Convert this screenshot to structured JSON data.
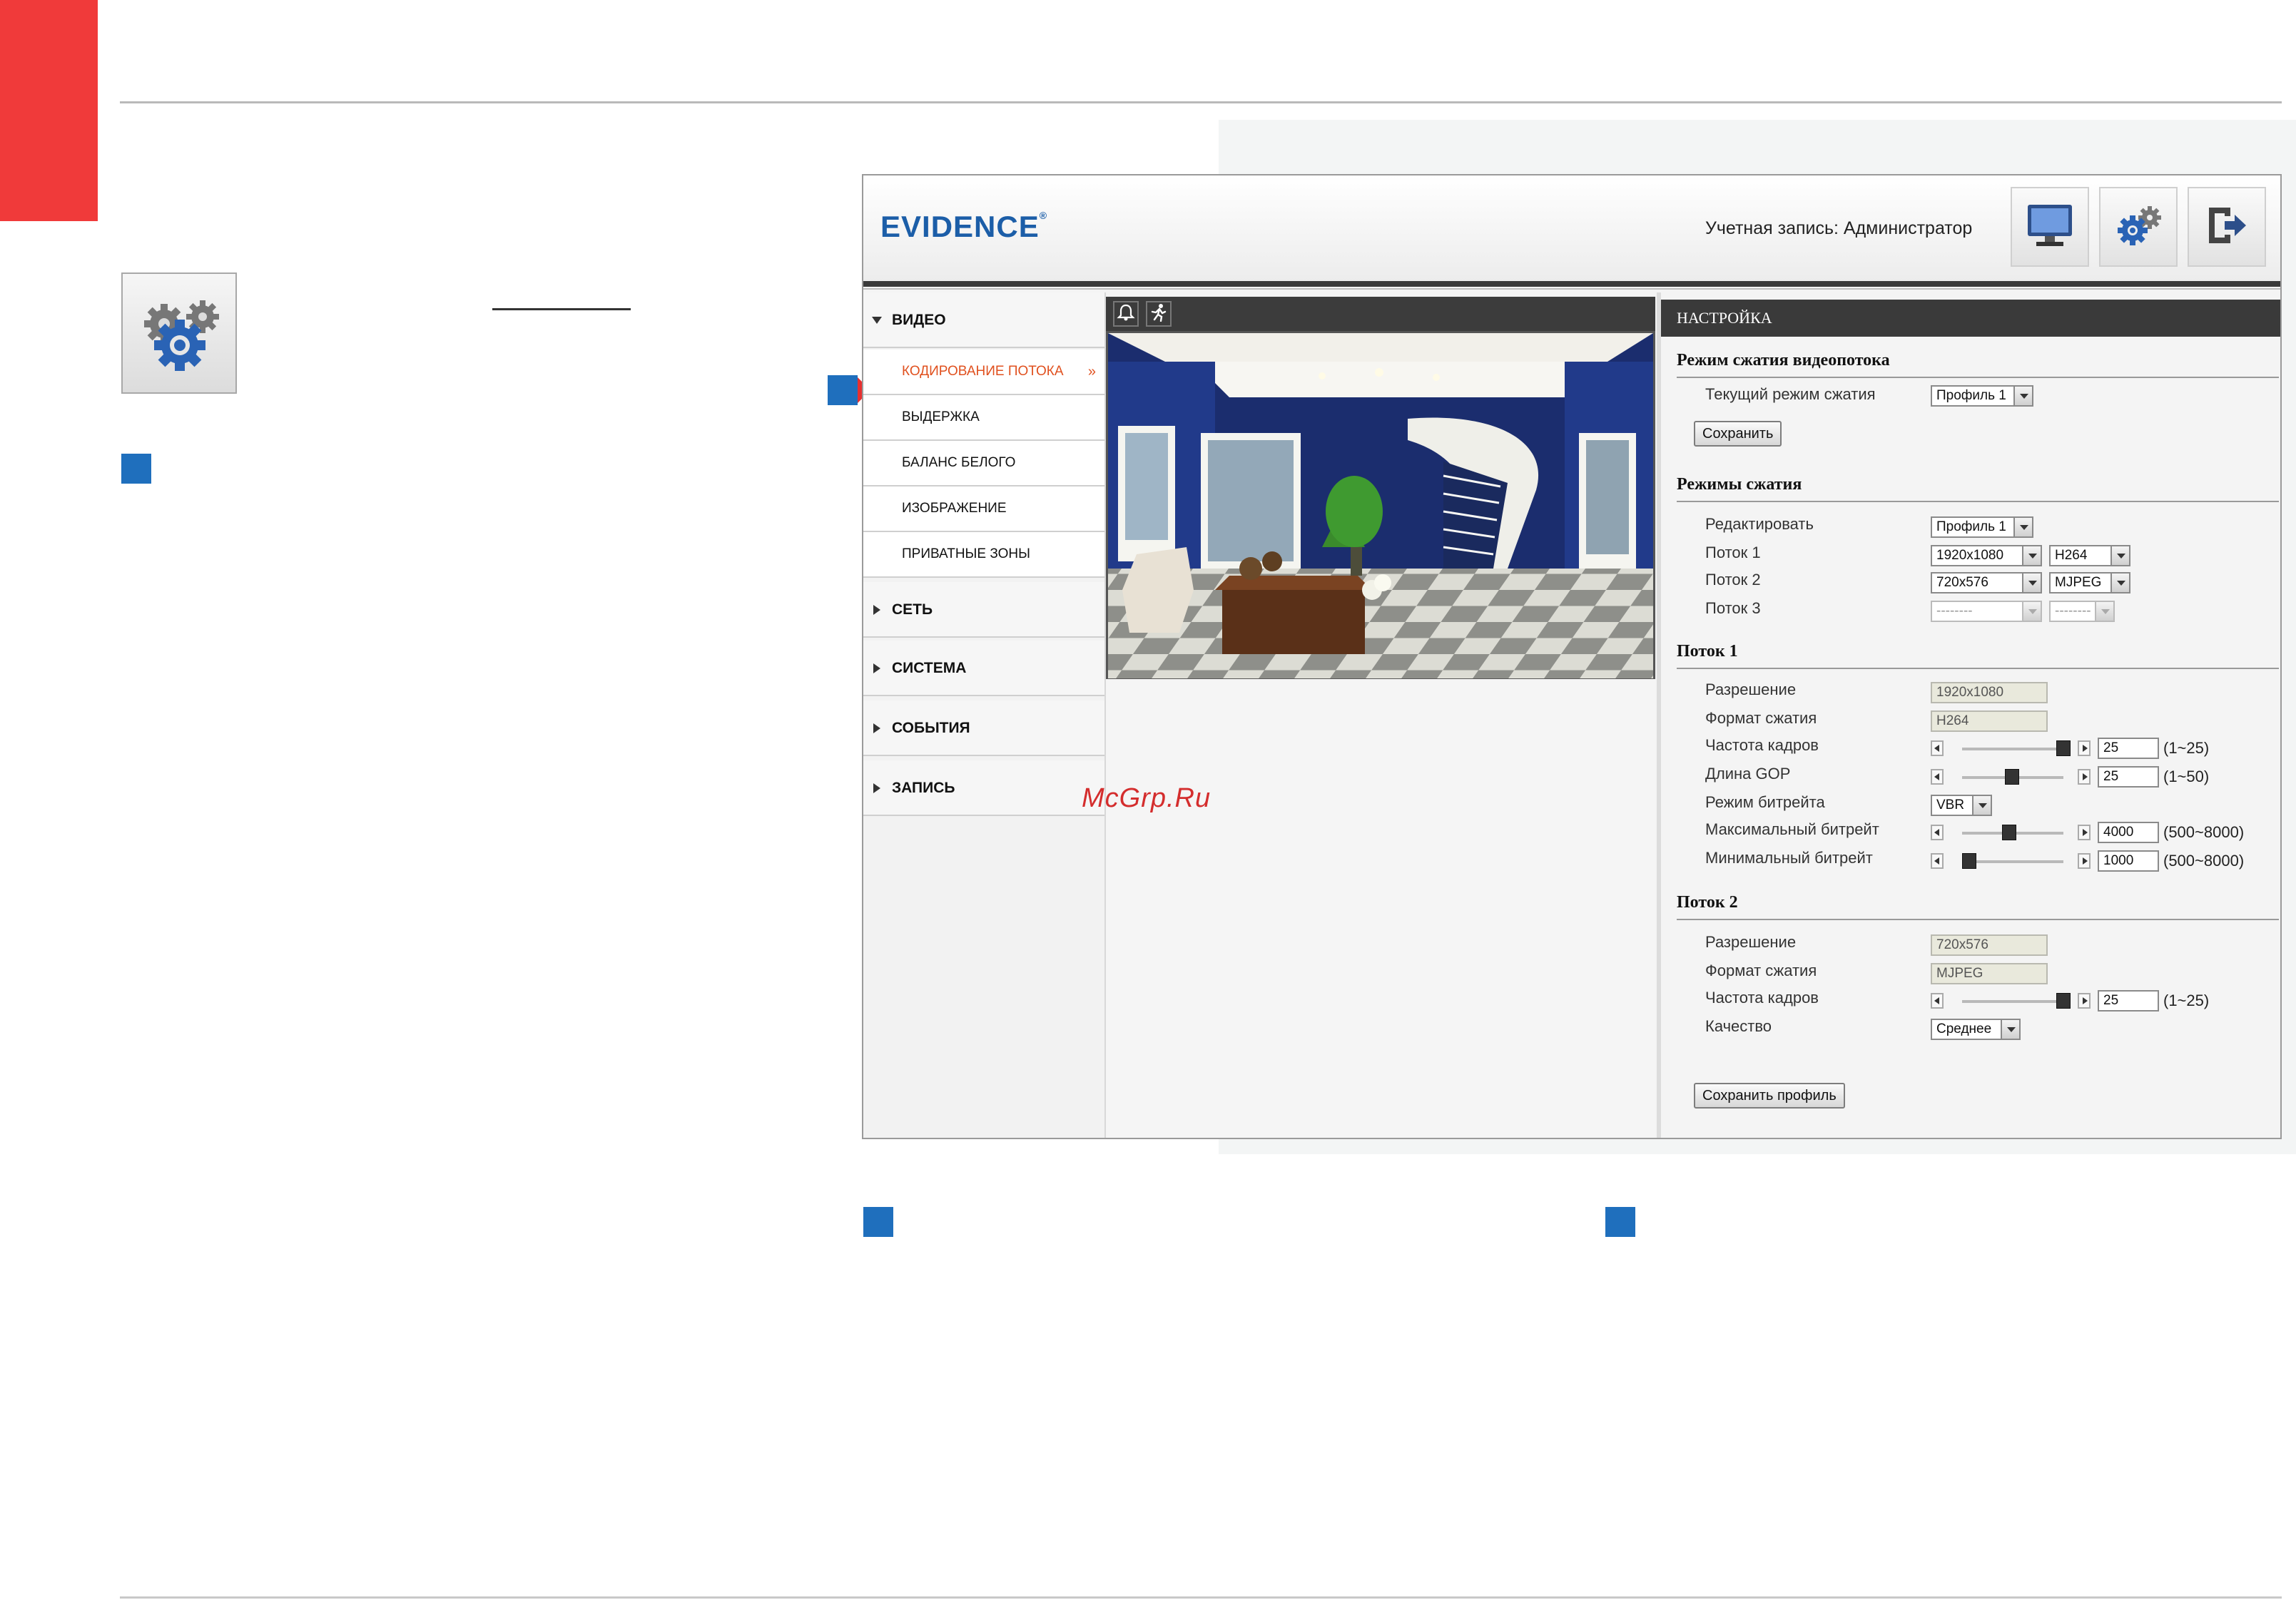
{
  "ui": {
    "logo": "EVIDENCE",
    "logo_mark": "®",
    "account": "Учетная запись: Администратор",
    "header_icons": [
      "monitor-icon",
      "gears-icon",
      "logout-icon"
    ]
  },
  "menu": {
    "video": "ВИДЕО",
    "video_items": [
      "КОДИРОВАНИЕ ПОТОКА",
      "ВЫДЕРЖКА",
      "БАЛАНС БЕЛОГО",
      "ИЗОБРАЖЕНИЕ",
      "ПРИВАТНЫЕ ЗОНЫ"
    ],
    "active_chevron": "»",
    "network": "СЕТЬ",
    "system": "СИСТЕМА",
    "events": "СОБЫТИЯ",
    "record": "ЗАПИСЬ"
  },
  "panel": {
    "header": "НАСТРОЙКА",
    "compression_mode": {
      "title": "Режим сжатия видеопотока",
      "current_label": "Текущий режим сжатия",
      "current_value": "Профиль 1",
      "save": "Сохранить"
    },
    "modes": {
      "title": "Режимы сжатия",
      "edit_label": "Редактировать",
      "edit_value": "Профиль 1",
      "stream1_label": "Поток 1",
      "stream1_res": "1920x1080",
      "stream1_codec": "H264",
      "stream2_label": "Поток 2",
      "stream2_res": "720x576",
      "stream2_codec": "MJPEG",
      "stream3_label": "Поток 3",
      "stream3_res": "--------",
      "stream3_codec": "--------"
    },
    "stream1": {
      "title": "Поток 1",
      "resolution_label": "Разрешение",
      "resolution": "1920x1080",
      "format_label": "Формат сжатия",
      "format": "H264",
      "fps_label": "Частота кадров",
      "fps": "25",
      "fps_range": "(1~25)",
      "gop_label": "Длина GOP",
      "gop": "25",
      "gop_range": "(1~50)",
      "bitrate_mode_label": "Режим битрейта",
      "bitrate_mode": "VBR",
      "max_bitrate_label": "Максимальный битрейт",
      "max_bitrate": "4000",
      "max_bitrate_range": "(500~8000)",
      "min_bitrate_label": "Минимальный битрейт",
      "min_bitrate": "1000",
      "min_bitrate_range": "(500~8000)"
    },
    "stream2": {
      "title": "Поток 2",
      "resolution_label": "Разрешение",
      "resolution": "720x576",
      "format_label": "Формат сжатия",
      "format": "MJPEG",
      "fps_label": "Частота кадров",
      "fps": "25",
      "fps_range": "(1~25)",
      "quality_label": "Качество",
      "quality": "Среднее"
    },
    "save_profile": "Сохранить профиль"
  },
  "watermark": "McGrp.Ru",
  "colors": {
    "accent_red": "#f03a3a",
    "marker_blue": "#1f6fbd",
    "logo_blue": "#1c5ea8",
    "active_orange": "#e0501e"
  }
}
